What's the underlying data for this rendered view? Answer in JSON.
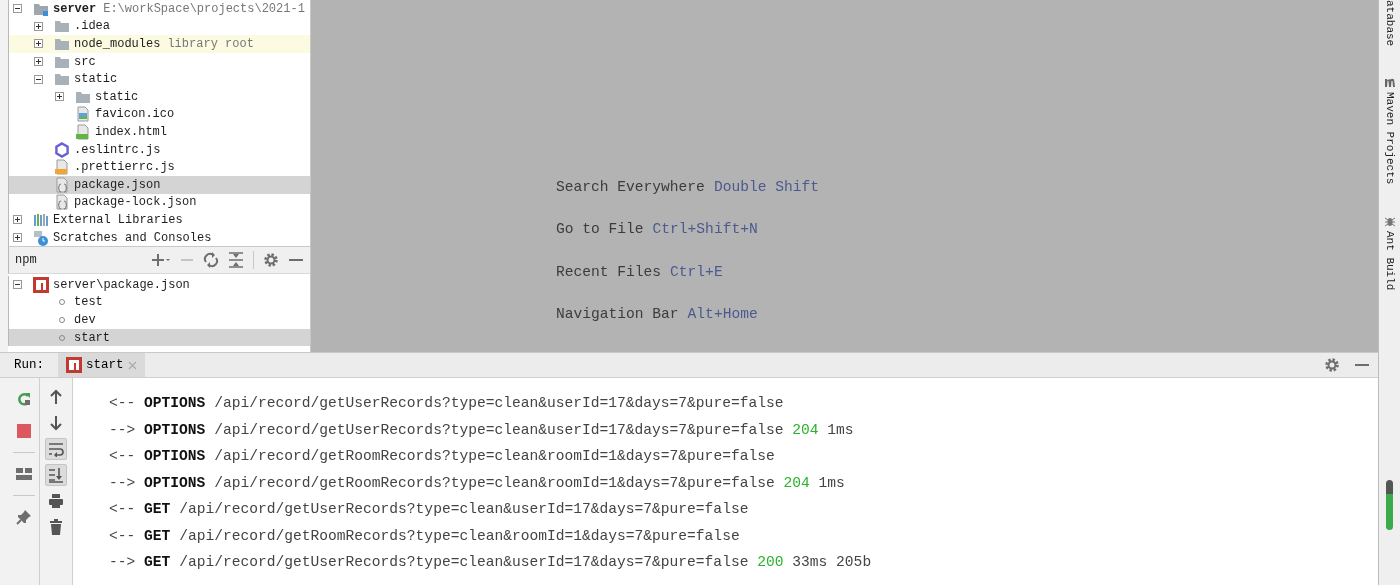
{
  "project_tree": {
    "items": [
      {
        "label": "server",
        "hint": "E:\\workSpace\\projects\\2021-1",
        "kind": "module",
        "expanded": true,
        "selected": false,
        "hovered": false,
        "children": [
          {
            "label": ".idea",
            "kind": "folder",
            "expanded": false,
            "selected": false,
            "hovered": false
          },
          {
            "label": "node_modules",
            "hint": "library root",
            "kind": "folder",
            "expanded": false,
            "selected": false,
            "hovered": true
          },
          {
            "label": "src",
            "kind": "folder",
            "expanded": false,
            "selected": false,
            "hovered": false
          },
          {
            "label": "static",
            "kind": "folder",
            "expanded": true,
            "selected": false,
            "hovered": false,
            "children": [
              {
                "label": "static",
                "kind": "folder",
                "expanded": false,
                "selected": false,
                "hovered": false
              },
              {
                "label": "favicon.ico",
                "kind": "image",
                "selected": false,
                "hovered": false
              },
              {
                "label": "index.html",
                "kind": "html",
                "selected": false,
                "hovered": false
              }
            ]
          },
          {
            "label": ".eslintrc.js",
            "kind": "eslint",
            "selected": false,
            "hovered": false
          },
          {
            "label": ".prettierrc.js",
            "kind": "js",
            "selected": false,
            "hovered": false
          },
          {
            "label": "package.json",
            "kind": "json",
            "selected": true,
            "hovered": false
          },
          {
            "label": "package-lock.json",
            "kind": "json",
            "selected": false,
            "hovered": false
          }
        ]
      },
      {
        "label": "External Libraries",
        "kind": "libraries",
        "expanded": false,
        "selected": false,
        "hovered": false
      },
      {
        "label": "Scratches and Consoles",
        "kind": "scratches",
        "expanded": false,
        "selected": false,
        "hovered": false
      }
    ]
  },
  "npm": {
    "title": "npm",
    "tools": [
      {
        "kind": "add",
        "disabled": false
      },
      {
        "kind": "remove",
        "disabled": true
      },
      {
        "kind": "refresh",
        "disabled": false
      },
      {
        "kind": "collapse",
        "disabled": false
      },
      {
        "kind": "gear",
        "disabled": false
      },
      {
        "kind": "minimize",
        "disabled": false
      }
    ],
    "items": [
      {
        "label": "server\\package.json",
        "kind": "npm",
        "expanded": true,
        "selected": false,
        "children": [
          {
            "label": "test",
            "kind": "script",
            "selected": false
          },
          {
            "label": "dev",
            "kind": "script",
            "selected": false
          },
          {
            "label": "start",
            "kind": "script",
            "selected": true
          }
        ]
      }
    ]
  },
  "welcome_hints": [
    {
      "label": "Search Everywhere",
      "shortcut": "Double Shift"
    },
    {
      "label": "Go to File",
      "shortcut": "Ctrl+Shift+N"
    },
    {
      "label": "Recent Files",
      "shortcut": "Ctrl+E"
    },
    {
      "label": "Navigation Bar",
      "shortcut": "Alt+Home"
    }
  ],
  "run": {
    "label": "Run:",
    "tabs": [
      {
        "label": "start",
        "selected": true
      }
    ],
    "tools": [
      {
        "kind": "gear"
      },
      {
        "kind": "minimize"
      }
    ],
    "left_toolbar": [
      {
        "kind": "rerun"
      },
      {
        "kind": "stop"
      },
      {
        "kind": "separator"
      },
      {
        "kind": "layout"
      },
      {
        "kind": "separator"
      },
      {
        "kind": "pin"
      }
    ],
    "second_toolbar": [
      {
        "kind": "up",
        "on": false
      },
      {
        "kind": "down",
        "on": false
      },
      {
        "kind": "wrap",
        "on": true
      },
      {
        "kind": "scroll-end",
        "on": true
      },
      {
        "kind": "print",
        "on": false
      },
      {
        "kind": "trash",
        "on": false
      }
    ],
    "console_lines": [
      {
        "direction": "<--",
        "method": "OPTIONS",
        "path": "/api/record/getUserRecords?type=clean&userId=17&days=7&pure=false"
      },
      {
        "direction": "-->",
        "method": "OPTIONS",
        "path": "/api/record/getUserRecords?type=clean&userId=17&days=7&pure=false",
        "status": "204",
        "time": "1ms"
      },
      {
        "direction": "<--",
        "method": "OPTIONS",
        "path": "/api/record/getRoomRecords?type=clean&roomId=1&days=7&pure=false"
      },
      {
        "direction": "-->",
        "method": "OPTIONS",
        "path": "/api/record/getRoomRecords?type=clean&roomId=1&days=7&pure=false",
        "status": "204",
        "time": "1ms"
      },
      {
        "direction": "<--",
        "method": "GET",
        "path": "/api/record/getUserRecords?type=clean&userId=17&days=7&pure=false"
      },
      {
        "direction": "<--",
        "method": "GET",
        "path": "/api/record/getRoomRecords?type=clean&roomId=1&days=7&pure=false"
      },
      {
        "direction": "-->",
        "method": "GET",
        "path": "/api/record/getUserRecords?type=clean&userId=17&days=7&pure=false",
        "status": "200",
        "time": "33ms",
        "size": "205b"
      }
    ]
  },
  "tool_strip": [
    {
      "label": "atabase",
      "kind": "none"
    },
    {
      "label": "Maven Projects",
      "kind": "maven"
    },
    {
      "label": "Ant Build",
      "kind": "ant"
    }
  ]
}
